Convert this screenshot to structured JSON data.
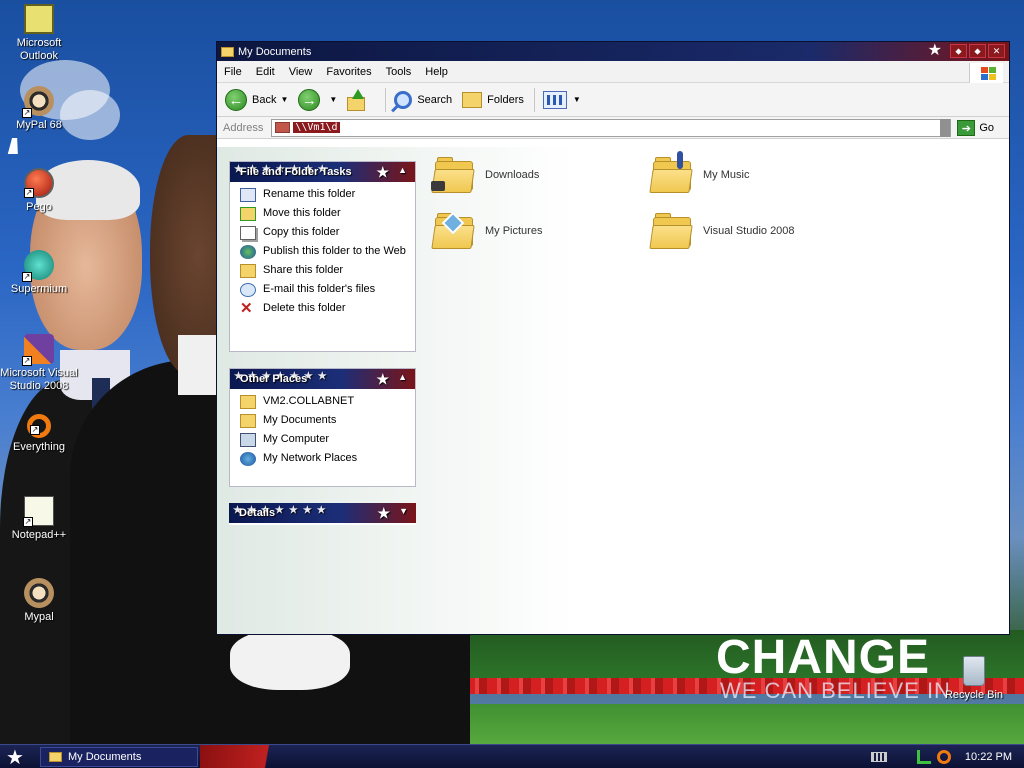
{
  "desktop": {
    "icons": [
      {
        "label": "Microsoft Outlook",
        "icon": "outlook-icon"
      },
      {
        "label": "MyPal 68",
        "icon": "mypal-raccoon-icon"
      },
      {
        "label": "Pego",
        "icon": "pego-icon"
      },
      {
        "label": "Supermium",
        "icon": "supermium-icon"
      },
      {
        "label": "Microsoft Visual Studio 2008",
        "icon": "visual-studio-icon"
      },
      {
        "label": "Everything",
        "icon": "everything-search-icon"
      },
      {
        "label": "Notepad++",
        "icon": "notepad-plus-plus-icon"
      },
      {
        "label": "Mypal",
        "icon": "mypal-raccoon-icon"
      }
    ],
    "recycle_bin": "Recycle Bin",
    "wallpaper_text": {
      "headline": "CHANGE",
      "sub": "WE CAN BELIEVE IN"
    }
  },
  "window": {
    "title": "My Documents",
    "menu": [
      "File",
      "Edit",
      "View",
      "Favorites",
      "Tools",
      "Help"
    ],
    "toolbar": {
      "back": "Back",
      "search": "Search",
      "folders": "Folders"
    },
    "address": {
      "label": "Address",
      "value": "\\\\Vm1\\d",
      "go": "Go"
    },
    "panes": {
      "file_tasks": {
        "title": "File and Folder Tasks",
        "items": [
          {
            "label": "Rename this folder",
            "icon": "rename-icon"
          },
          {
            "label": "Move this folder",
            "icon": "move-icon"
          },
          {
            "label": "Copy this folder",
            "icon": "copy-icon"
          },
          {
            "label": "Publish this folder to the Web",
            "icon": "globe-icon"
          },
          {
            "label": "Share this folder",
            "icon": "share-icon"
          },
          {
            "label": "E-mail this folder's files",
            "icon": "email-icon"
          },
          {
            "label": "Delete this folder",
            "icon": "delete-icon"
          }
        ]
      },
      "other_places": {
        "title": "Other Places",
        "items": [
          {
            "label": "VM2.COLLABNET",
            "icon": "folder-icon"
          },
          {
            "label": "My Documents",
            "icon": "my-documents-icon"
          },
          {
            "label": "My Computer",
            "icon": "my-computer-icon"
          },
          {
            "label": "My Network Places",
            "icon": "network-places-icon"
          }
        ]
      },
      "details": {
        "title": "Details"
      }
    },
    "folders": [
      {
        "label": "Downloads"
      },
      {
        "label": "My Music"
      },
      {
        "label": "My Pictures"
      },
      {
        "label": "Visual Studio 2008"
      }
    ]
  },
  "taskbar": {
    "task": "My Documents",
    "clock": "10:22 PM"
  },
  "colors": {
    "title_navy": "#0c1640",
    "title_red": "#7a1418",
    "folder_yellow": "#f0c850"
  }
}
